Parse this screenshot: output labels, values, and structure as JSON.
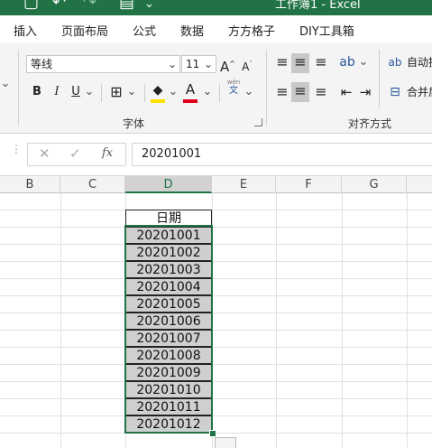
{
  "window": {
    "title": "工作簿1 - Excel"
  },
  "ribbon_tabs": [
    "插入",
    "页面布局",
    "公式",
    "数据",
    "方方格子",
    "DIY工具箱"
  ],
  "font_group": {
    "font_name": "等线",
    "font_size": "11",
    "bold": "B",
    "italic": "I",
    "underline": "U",
    "grow": "A",
    "shrink": "A",
    "font_color_letter": "A",
    "phonetic": "文",
    "label": "字体"
  },
  "alignment_group": {
    "wrap_label": "自动换",
    "merge_label": "合并后",
    "label": "对齐方式"
  },
  "formula_bar": {
    "fx_label": "fx",
    "value": "20201001"
  },
  "columns": [
    "B",
    "C",
    "D",
    "E",
    "F",
    "G"
  ],
  "selected_column": "D",
  "sheet": {
    "header": "日期",
    "values": [
      "20201001",
      "20201002",
      "20201003",
      "20201004",
      "20201005",
      "20201006",
      "20201007",
      "20201008",
      "20201009",
      "20201010",
      "20201011",
      "20201012"
    ]
  },
  "colors": {
    "accent": "#217346",
    "selection_fill": "#cfcfcf",
    "font_color_bar": "#e0001b",
    "highlight_bar": "#ffe100"
  }
}
